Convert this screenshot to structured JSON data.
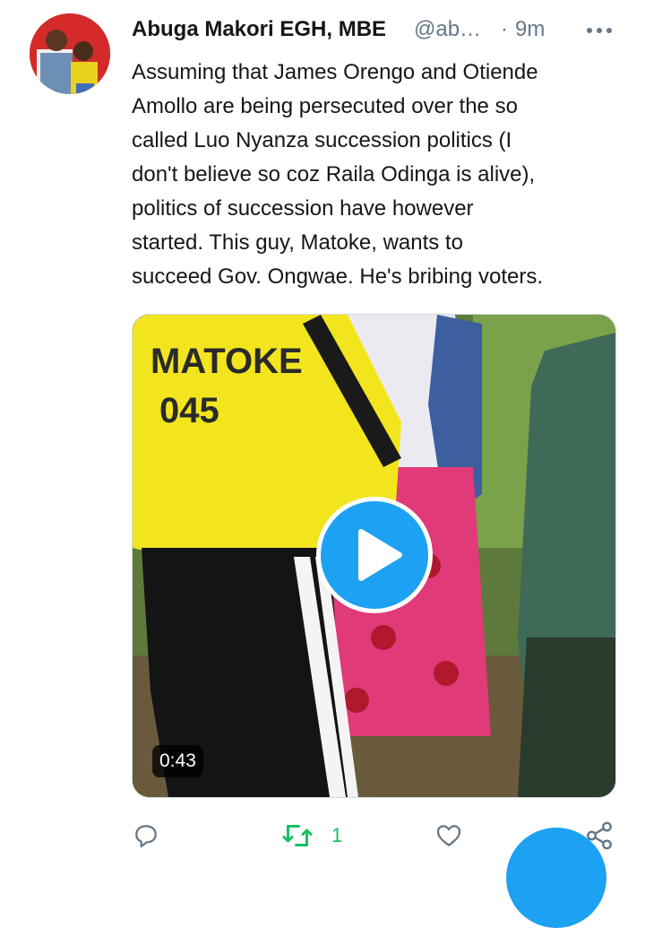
{
  "tweet": {
    "author_name": "Abuga Makori EGH, MBE",
    "handle": "@ab…",
    "separator": "·",
    "time": "9m",
    "text": "Assuming that James Orengo and Otiende\nAmollo are being persecuted over the so\ncalled Luo Nyanza succession politics (I\ndon't believe so coz Raila Odinga is alive),\npolitics of succession have however\nstarted. This guy, Matoke, wants to\nsucceed Gov. Ongwae. He's bribing voters.",
    "video": {
      "duration": "0:43",
      "shirt_text_line1": "MATOKE",
      "shirt_text_line2": "045"
    }
  },
  "actions": {
    "reply_icon": "reply-icon",
    "retweet_icon": "retweet-icon",
    "retweet_count": "1",
    "like_icon": "heart-icon",
    "share_icon": "share-icon"
  },
  "colors": {
    "accent": "#1da1f2",
    "retweet_green": "#17bf63",
    "secondary_text": "#657786"
  }
}
